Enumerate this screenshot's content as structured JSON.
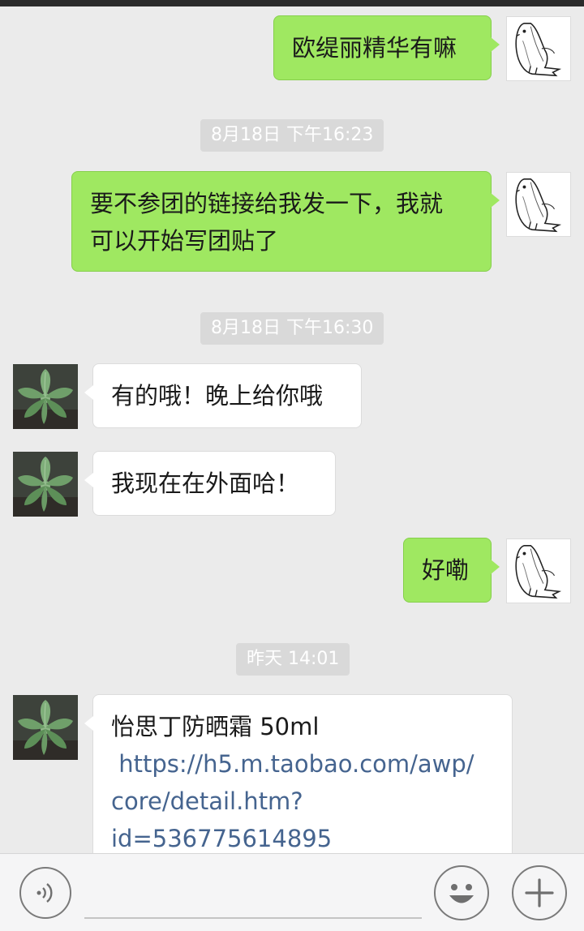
{
  "messages": {
    "m1": "欧缇丽精华有嘛",
    "m2_line1": "要不参团的链接给我发一下，我就",
    "m2_line2": "可以开始写团贴了",
    "m3": "有的哦！晚上给你哦",
    "m4": "我现在在外面哈！",
    "m5": "好嘞",
    "m6_line1": "怡思丁防晒霜 50ml",
    "m6_link_line1": " https://h5.m.taobao.com/awp/",
    "m6_link_line2": "core/detail.htm?",
    "m6_link_line3": "id=536775614895"
  },
  "timestamps": {
    "t1": "8月18日 下午16:23",
    "t2": "8月18日 下午16:30",
    "t3": "昨天 14:01"
  },
  "icons": {
    "voice": "voice-icon",
    "emoji": "smiley-icon",
    "plus": "plus-icon",
    "self_avatar": "fish-sketch-avatar",
    "contact_avatar": "succulent-plant-avatar"
  },
  "colors": {
    "sent_bubble": "#9fe861",
    "received_bubble": "#ffffff",
    "background": "#ebebeb",
    "timestamp_bg": "#d9d9d9",
    "link": "#45648f"
  }
}
